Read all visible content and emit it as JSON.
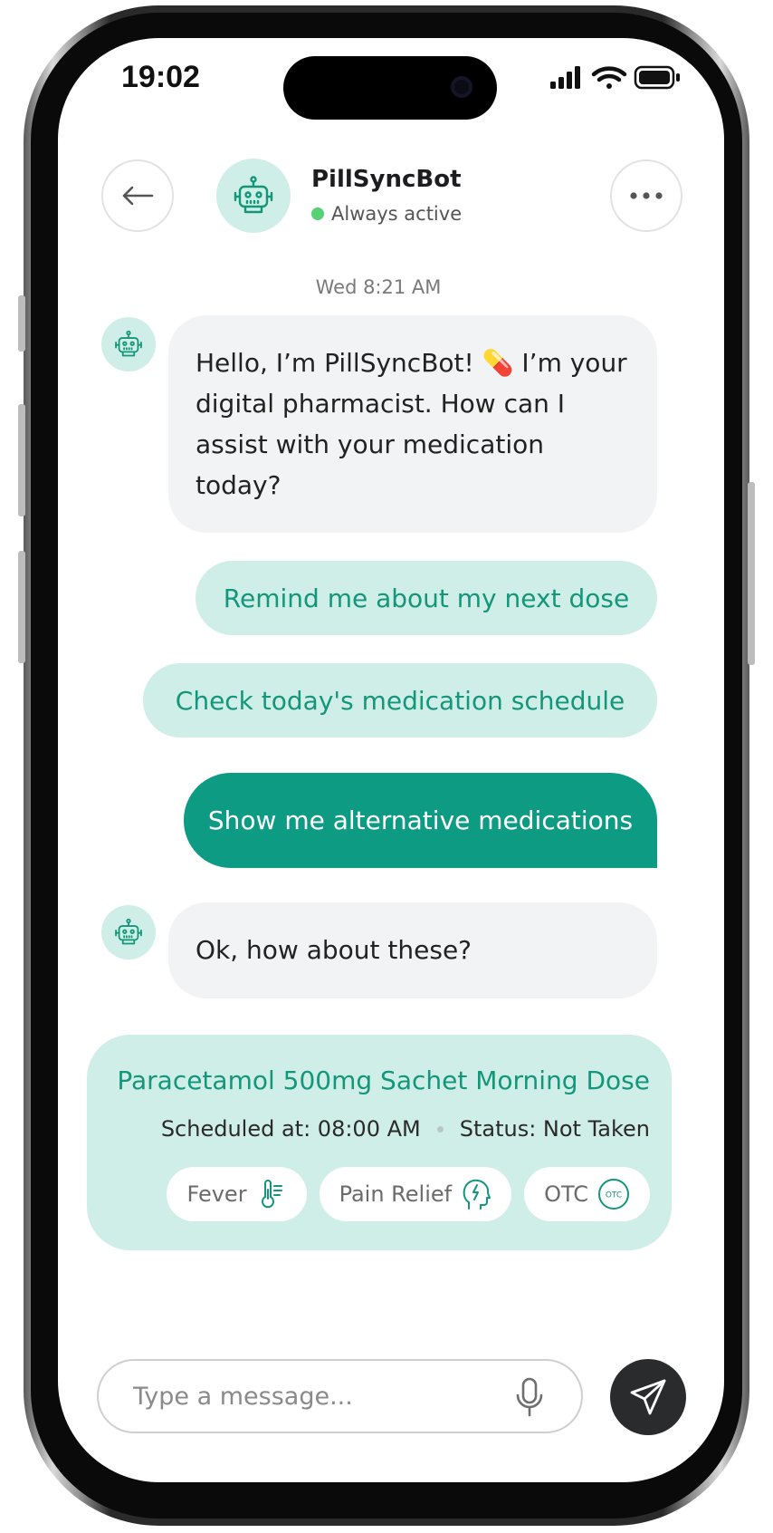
{
  "status_bar": {
    "time": "19:02"
  },
  "header": {
    "bot_name": "PillSyncBot",
    "bot_status": "Always active",
    "back_icon": "arrow-left-icon",
    "more_icon": "ellipsis-icon",
    "avatar_icon": "robot-icon"
  },
  "chat": {
    "timestamp": "Wed 8:21 AM",
    "bot_greeting": "Hello, I’m PillSyncBot! 💊 I’m your digital pharmacist. How can I assist with your medication today?",
    "suggestions": [
      "Remind me about my next dose",
      "Check today's medication schedule"
    ],
    "user_message": "Show me alternative medications",
    "bot_reply": "Ok, how about these?"
  },
  "medication_card": {
    "title": "Paracetamol 500mg Sachet Morning Dose",
    "scheduled": "Scheduled at: 08:00 AM",
    "status": "Status: Not Taken",
    "tags": [
      {
        "label": "Fever",
        "icon": "thermometer-icon"
      },
      {
        "label": "Pain Relief",
        "icon": "head-pain-icon"
      },
      {
        "label": "OTC",
        "icon": "otc-badge-icon",
        "badge_text": "OTC"
      }
    ]
  },
  "composer": {
    "placeholder": "Type a message...",
    "mic_icon": "microphone-icon",
    "send_icon": "send-icon"
  },
  "colors": {
    "accent": "#0d9b84",
    "accent_light": "#cfeee7",
    "accent_text": "#14967a",
    "bot_bubble": "#f2f3f4",
    "online": "#56d173"
  }
}
